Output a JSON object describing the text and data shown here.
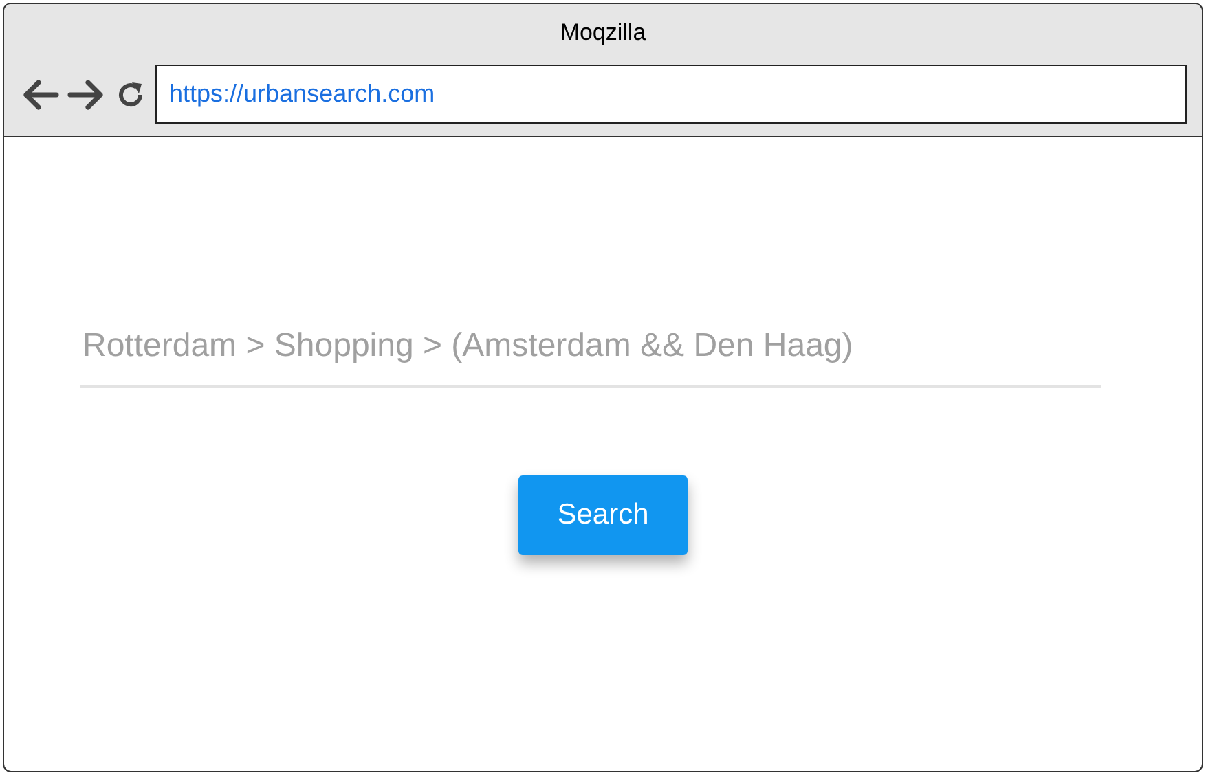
{
  "window": {
    "title": "Moqzilla"
  },
  "browser": {
    "address": "https://urbansearch.com"
  },
  "search": {
    "placeholder": "Rotterdam > Shopping > (Amsterdam && Den Haag)"
  },
  "buttons": [
    {
      "label": "Search"
    }
  ]
}
